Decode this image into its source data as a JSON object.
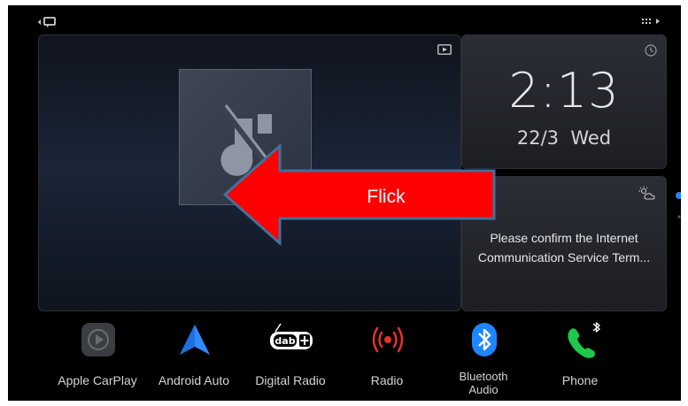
{
  "clock": {
    "time": "2:13",
    "date": "22/3  Wed"
  },
  "notice": {
    "line1": "Please confirm the Internet",
    "line2": "Communication Service Term..."
  },
  "overlay": {
    "label": "Flick"
  },
  "apps": [
    {
      "label": "Apple CarPlay",
      "icon": "carplay-icon"
    },
    {
      "label": "Android Auto",
      "icon": "android-auto-icon"
    },
    {
      "label": "Digital Radio",
      "icon": "dab-icon"
    },
    {
      "label": "Radio",
      "icon": "radio-icon"
    },
    {
      "label": "Bluetooth Audio",
      "label_line1": "Bluetooth",
      "label_line2": "Audio",
      "icon": "bluetooth-icon"
    },
    {
      "label": "Phone",
      "icon": "phone-icon"
    }
  ],
  "colors": {
    "arrow_fill": "#ff0000",
    "arrow_outline": "#41719c",
    "accent_blue": "#1e86ff",
    "radio_red": "#e8312a",
    "phone_green": "#1ec84a"
  }
}
